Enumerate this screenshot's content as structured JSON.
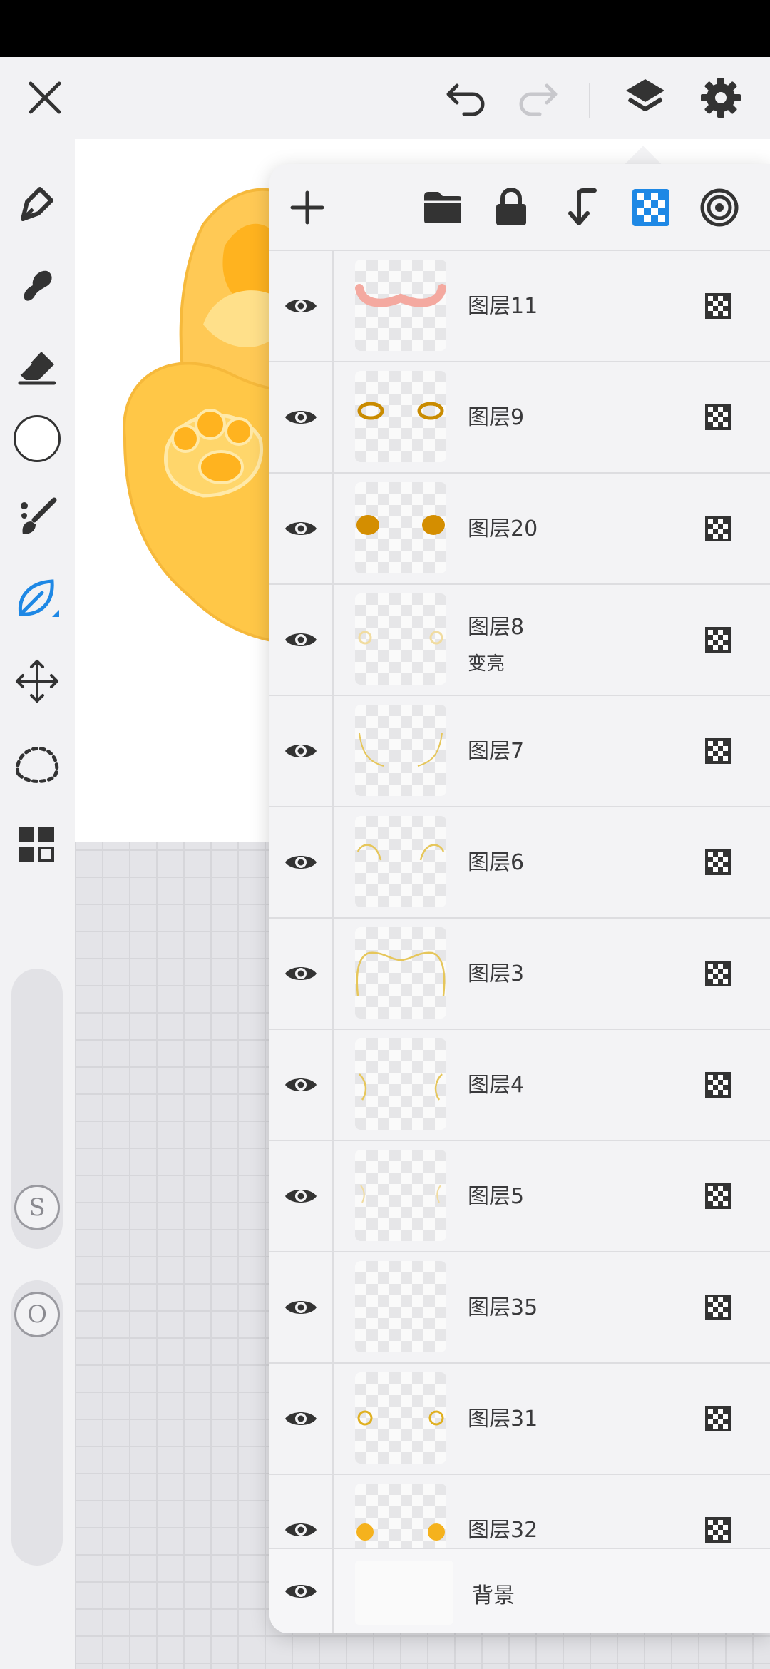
{
  "toolbar": {
    "close_icon": "close-icon",
    "undo_icon": "undo-icon",
    "redo_icon": "redo-icon",
    "layers_icon": "layers-icon",
    "settings_icon": "gear-icon"
  },
  "tools": [
    {
      "name": "pen-tool",
      "icon": "pen-icon"
    },
    {
      "name": "smudge-tool",
      "icon": "smudge-icon"
    },
    {
      "name": "eraser-tool",
      "icon": "eraser-icon"
    },
    {
      "name": "color-swatch",
      "icon": "color-circle-icon",
      "color": "#ffffff"
    },
    {
      "name": "brush-tool",
      "icon": "brush-icon"
    },
    {
      "name": "leaf-brush-tool",
      "icon": "leaf-icon",
      "active": true
    },
    {
      "name": "move-tool",
      "icon": "move-icon"
    },
    {
      "name": "lasso-tool",
      "icon": "lasso-icon"
    },
    {
      "name": "more-tools",
      "icon": "grid-icon"
    }
  ],
  "sliders": {
    "size_label": "S",
    "opacity_label": "O"
  },
  "layer_panel": {
    "actions": [
      "add-layer-icon",
      "folder-icon",
      "lock-icon",
      "merge-down-icon",
      "alpha-lock-icon",
      "blend-target-icon"
    ],
    "accent_color": "#1e88e5",
    "layers": [
      {
        "name": "图层11",
        "mode": "",
        "thumb": "blush"
      },
      {
        "name": "图层9",
        "mode": "",
        "thumb": "rings"
      },
      {
        "name": "图层20",
        "mode": "",
        "thumb": "dots"
      },
      {
        "name": "图层8",
        "mode": "变亮",
        "thumb": "paws-faint"
      },
      {
        "name": "图层7",
        "mode": "",
        "thumb": "curves-low"
      },
      {
        "name": "图层6",
        "mode": "",
        "thumb": "arcs"
      },
      {
        "name": "图层3",
        "mode": "",
        "thumb": "outline"
      },
      {
        "name": "图层4",
        "mode": "",
        "thumb": "sides"
      },
      {
        "name": "图层5",
        "mode": "",
        "thumb": "faint-sides"
      },
      {
        "name": "图层35",
        "mode": "",
        "thumb": "empty"
      },
      {
        "name": "图层31",
        "mode": "",
        "thumb": "paws-outline"
      },
      {
        "name": "图层32",
        "mode": "",
        "thumb": "flowers"
      }
    ],
    "background_label": "背景"
  }
}
